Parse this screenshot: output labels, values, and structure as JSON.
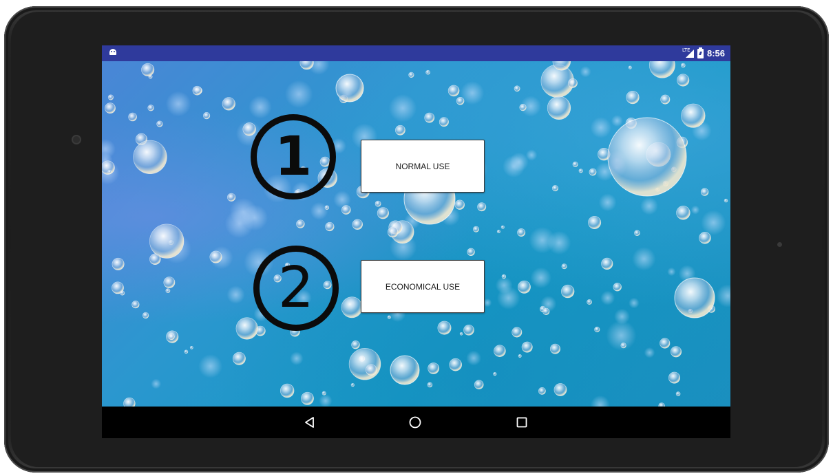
{
  "status_bar": {
    "network_label": "LTE",
    "time": "8:56",
    "icons": [
      "android-icon",
      "lte-signal-icon",
      "battery-charging-icon"
    ]
  },
  "main": {
    "steps": [
      {
        "number": "1",
        "button_label": "NORMAL USE"
      },
      {
        "number": "2",
        "button_label": "ECONOMICAL USE"
      }
    ]
  },
  "nav_bar": {
    "icons": [
      "back-icon",
      "home-icon",
      "recents-icon"
    ]
  },
  "colors": {
    "status_bar": "#2f3a9c",
    "background_water": "#1b86c0",
    "button_face": "#ffffff",
    "step_number": "#0b0b0b",
    "nav_bar": "#000000"
  }
}
